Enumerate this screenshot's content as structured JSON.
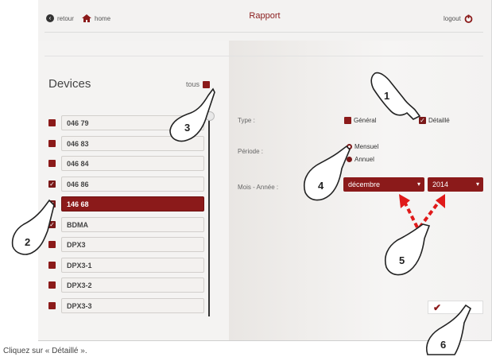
{
  "header": {
    "back_label": "retour",
    "home_label": "home",
    "title": "Rapport",
    "logout_label": "logout"
  },
  "devices": {
    "title": "Devices",
    "all_label": "tous",
    "items": [
      {
        "label": "046 79",
        "checked": false,
        "active": false
      },
      {
        "label": "046 83",
        "checked": false,
        "active": false
      },
      {
        "label": "046 84",
        "checked": false,
        "active": false
      },
      {
        "label": "046 86",
        "checked": true,
        "active": false
      },
      {
        "label": "146 68",
        "checked": true,
        "active": true
      },
      {
        "label": "BDMA",
        "checked": true,
        "active": false
      },
      {
        "label": "DPX3",
        "checked": false,
        "active": false
      },
      {
        "label": "DPX3-1",
        "checked": false,
        "active": false
      },
      {
        "label": "DPX3-2",
        "checked": false,
        "active": false
      },
      {
        "label": "DPX3-3",
        "checked": false,
        "active": false
      }
    ]
  },
  "form": {
    "type_label": "Type :",
    "type_options": [
      "Général",
      "Détaillé"
    ],
    "type_selected": "Détaillé",
    "period_label": "Période :",
    "period_options": [
      "Mensuel",
      "Annuel"
    ],
    "period_selected": "Mensuel",
    "month_year_label": "Mois - Année :",
    "month_value": "décembre",
    "year_value": "2014"
  },
  "actions": {
    "validate_label": ""
  },
  "annotations": {
    "steps": [
      "1",
      "2",
      "3",
      "4",
      "5",
      "6"
    ]
  },
  "caption": "Cliquez sur « Détaillé »."
}
